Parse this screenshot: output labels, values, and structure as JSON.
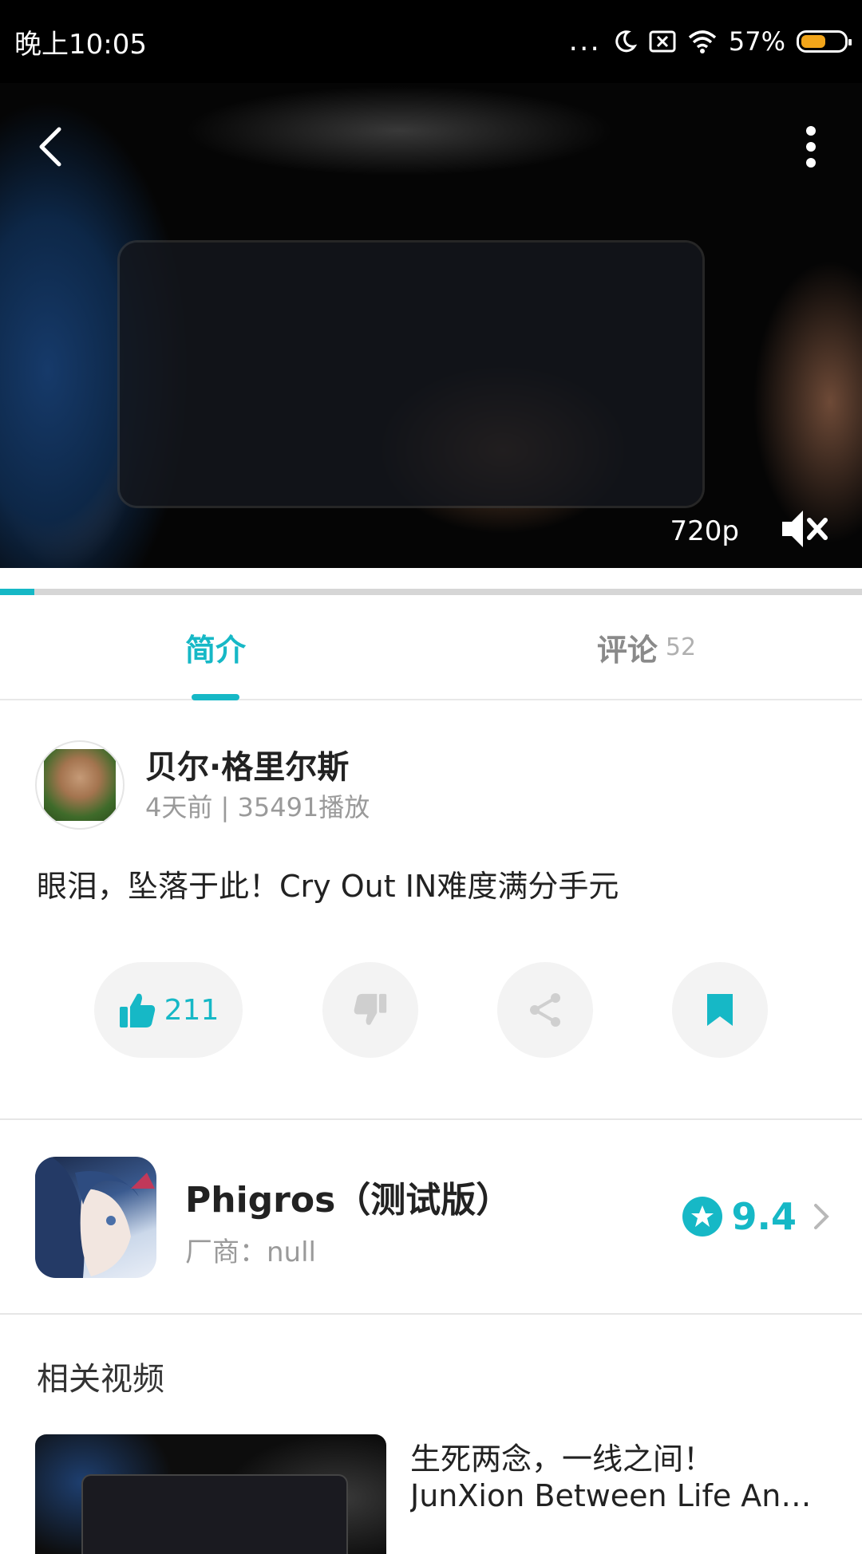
{
  "status_bar": {
    "time": "晚上10:05",
    "dots": "...",
    "battery_percent": "57%",
    "battery_level": 0.57,
    "battery_color": "#f2a51a"
  },
  "video": {
    "quality": "720p",
    "progress": 0.04,
    "icons": [
      "back-arrow-icon",
      "more-vertical-icon",
      "mute-icon"
    ]
  },
  "tabs": [
    {
      "label": "简介",
      "active": true
    },
    {
      "label": "评论",
      "count": "52",
      "active": false
    }
  ],
  "author": {
    "name": "贝尔·格里尔斯",
    "meta": "4天前 | 35491播放"
  },
  "video_title": "眼泪，坠落于此！Cry Out IN难度满分手元",
  "actions": {
    "like_count": "211"
  },
  "app": {
    "name": "Phigros（测试版）",
    "vendor": "厂商：null",
    "rating": "9.4"
  },
  "related": {
    "title": "相关视频",
    "items": [
      {
        "line1": "生死两念，一线之间！",
        "line2": "JunXion Between Life And..."
      }
    ]
  },
  "colors": {
    "accent": "#16b8c6"
  }
}
